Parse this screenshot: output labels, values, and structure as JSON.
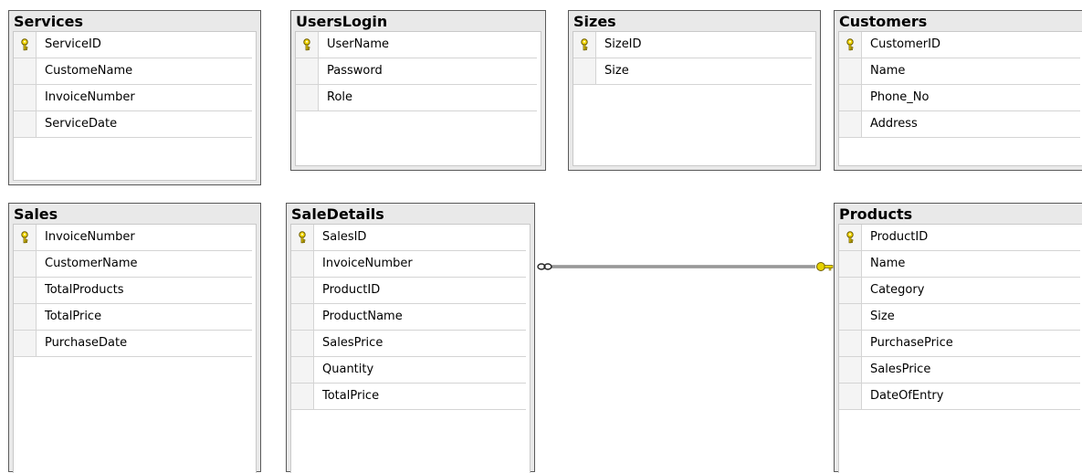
{
  "tables": {
    "services": {
      "title": "Services",
      "columns": [
        {
          "name": "ServiceID",
          "key": true
        },
        {
          "name": "CustomeName"
        },
        {
          "name": "InvoiceNumber"
        },
        {
          "name": "ServiceDate"
        }
      ]
    },
    "userslogin": {
      "title": "UsersLogin",
      "columns": [
        {
          "name": "UserName",
          "key": true
        },
        {
          "name": "Password"
        },
        {
          "name": "Role"
        }
      ]
    },
    "sizes": {
      "title": "Sizes",
      "columns": [
        {
          "name": "SizeID",
          "key": true
        },
        {
          "name": "Size"
        }
      ]
    },
    "customers": {
      "title": "Customers",
      "columns": [
        {
          "name": "CustomerID",
          "key": true
        },
        {
          "name": "Name"
        },
        {
          "name": "Phone_No"
        },
        {
          "name": "Address"
        }
      ]
    },
    "sales": {
      "title": "Sales",
      "columns": [
        {
          "name": "InvoiceNumber",
          "key": true
        },
        {
          "name": "CustomerName"
        },
        {
          "name": "TotalProducts"
        },
        {
          "name": "TotalPrice"
        },
        {
          "name": "PurchaseDate"
        }
      ]
    },
    "saledetails": {
      "title": "SaleDetails",
      "columns": [
        {
          "name": "SalesID",
          "key": true
        },
        {
          "name": "InvoiceNumber"
        },
        {
          "name": "ProductID"
        },
        {
          "name": "ProductName"
        },
        {
          "name": "SalesPrice"
        },
        {
          "name": "Quantity"
        },
        {
          "name": "TotalPrice"
        }
      ]
    },
    "products": {
      "title": "Products",
      "columns": [
        {
          "name": "ProductID",
          "key": true
        },
        {
          "name": "Name"
        },
        {
          "name": "Category"
        },
        {
          "name": "Size"
        },
        {
          "name": "PurchasePrice"
        },
        {
          "name": "SalesPrice"
        },
        {
          "name": "DateOfEntry"
        }
      ]
    }
  },
  "relationships": [
    {
      "from": "saledetails",
      "to": "products",
      "from_end": "many",
      "to_end": "one",
      "key_color": "#e6d200"
    }
  ]
}
